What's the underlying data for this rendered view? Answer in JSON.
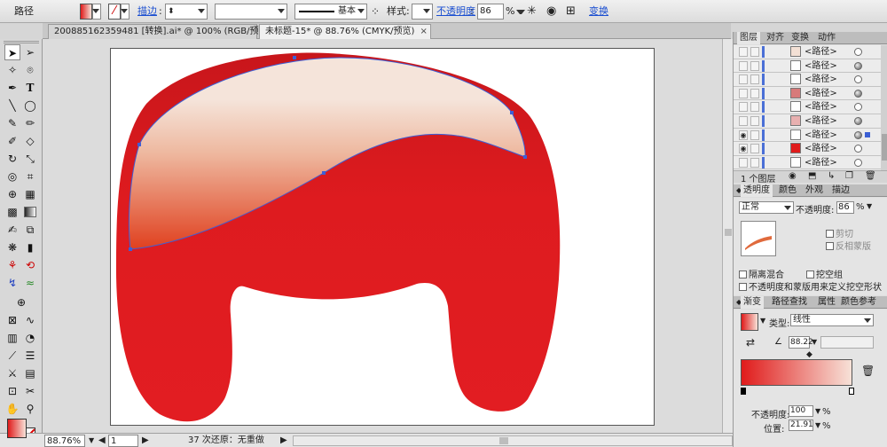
{
  "control_bar": {
    "selection_label": "路径",
    "stroke_label": "描边",
    "stroke_profile_label": "基本",
    "style_label": "样式",
    "opacity_label": "不透明度",
    "opacity_value": "86",
    "opacity_unit": "%",
    "transform_label": "变换"
  },
  "document_tabs": [
    {
      "label": "200885162359481 [转换].ai* @ 100% (RGB/预览)",
      "close": "×"
    },
    {
      "label": "未标题-15* @ 88.76% (CMYK/预览)",
      "close": "×"
    }
  ],
  "status_bar": {
    "zoom": "88.76%",
    "artboard_number": "1",
    "message": "37 次还原：无重做"
  },
  "layers_panel": {
    "tabs": [
      "图层",
      "对齐",
      "变换",
      "动作"
    ],
    "rows": [
      {
        "name": "<路径>",
        "thumb_color": "#f3e0d5",
        "target_filled": false,
        "eye": false
      },
      {
        "name": "<路径>",
        "thumb_color": "#ffffff",
        "target_filled": true,
        "eye": false
      },
      {
        "name": "<路径>",
        "thumb_color": "#ffffff",
        "target_filled": false,
        "eye": false
      },
      {
        "name": "<路径>",
        "thumb_color": "#d77a7a",
        "target_filled": true,
        "eye": false
      },
      {
        "name": "<路径>",
        "thumb_color": "#ffffff",
        "target_filled": false,
        "eye": false
      },
      {
        "name": "<路径>",
        "thumb_color": "#e8b0b0",
        "target_filled": true,
        "eye": false
      },
      {
        "name": "<路径>",
        "thumb_color": "#ffffff",
        "target_filled": true,
        "eye": true,
        "selected": true
      },
      {
        "name": "<路径>",
        "thumb_color": "#e01b1b",
        "target_filled": false,
        "eye": true
      },
      {
        "name": "<路径>",
        "thumb_color": "#ffffff",
        "target_filled": false,
        "eye": false
      }
    ],
    "layer_count": "1 个图层"
  },
  "transparency_panel": {
    "tabs": [
      "透明度",
      "颜色",
      "外观",
      "描边"
    ],
    "blend_mode": "正常",
    "opacity_label": "不透明度:",
    "opacity_value": "86",
    "opacity_unit": "%",
    "clip_label": "剪切",
    "invert_mask_label": "反相蒙版",
    "isolate_blending_label": "隔离混合",
    "knockout_group_label": "挖空组",
    "opacity_mask_label": "不透明度和蒙版用来定义挖空形状"
  },
  "gradient_panel": {
    "tabs": [
      "渐变",
      "路径查找",
      "属性",
      "颜色参考"
    ],
    "type_label": "类型:",
    "type_value": "线性",
    "angle_value": "88.22",
    "opacity_label": "不透明度:",
    "opacity_value": "100",
    "location_label": "位置:",
    "location_value": "21.91",
    "percent": "%"
  },
  "colors": {
    "hair_red": "#e01b1b",
    "highlight_light": "#f5e4da",
    "selection_blue": "#3d5fd6"
  }
}
